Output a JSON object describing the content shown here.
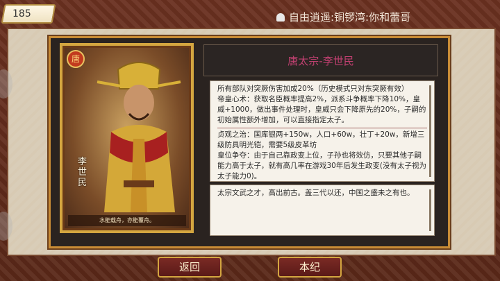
{
  "header": {
    "counter_value": "185",
    "player_line": "自由逍遥:铜锣湾:你和蕾哥"
  },
  "card": {
    "side_name": "李世民",
    "ornament_char": "唐",
    "caption": "水能载舟，亦能覆舟。"
  },
  "detail": {
    "title": "唐太宗-李世民",
    "trait_1": "所有部队对突厥伤害加成20%（历史模式只对东突厥有效）",
    "trait_2": "帝皇心术：获取名臣概率提高2%，派系斗争概率下降10%，皇威+1000，做出事件处理时，皇威只会下降原先的20%，子嗣的初始属性额外增加，可以直接指定太子。",
    "trait_3": "贞观之治：国库银两+150w，人口+60w，壮丁+20w，新增三级防具明光铠，需要5级皮革坊",
    "trait_4": "皇位争夺：由于自己靠政变上位，子孙也将效仿，只要其他子嗣能力高于太子，就有高几率在游戏30年后发生政变(没有太子视为太子能力0)。",
    "quote": "太宗文武之才，高出前古。盖三代以还，中国之盛未之有也。"
  },
  "buttons": {
    "back_label": "返回",
    "bio_label": "本纪"
  },
  "colors": {
    "accent_gold": "#c98c36",
    "title_pink": "#c04070",
    "button_red": "#7a2a24"
  }
}
